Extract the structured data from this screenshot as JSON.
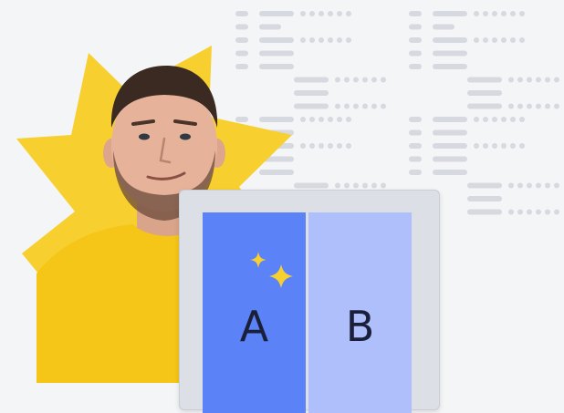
{
  "colors": {
    "background": "#f4f5f7",
    "placeholder_lines": "#d6d9df",
    "burst": "#f7d02f",
    "shirt": "#f5c518",
    "card_frame": "#dcdfe6",
    "variant_a": "#5b83f7",
    "variant_b": "#aebffc",
    "label": "#1a1f3a",
    "sparkle": "#f7d02f"
  },
  "variants": [
    {
      "label": "A",
      "highlighted": true
    },
    {
      "label": "B",
      "highlighted": false
    }
  ],
  "icons": [
    "starburst-icon",
    "sparkle-icon"
  ]
}
